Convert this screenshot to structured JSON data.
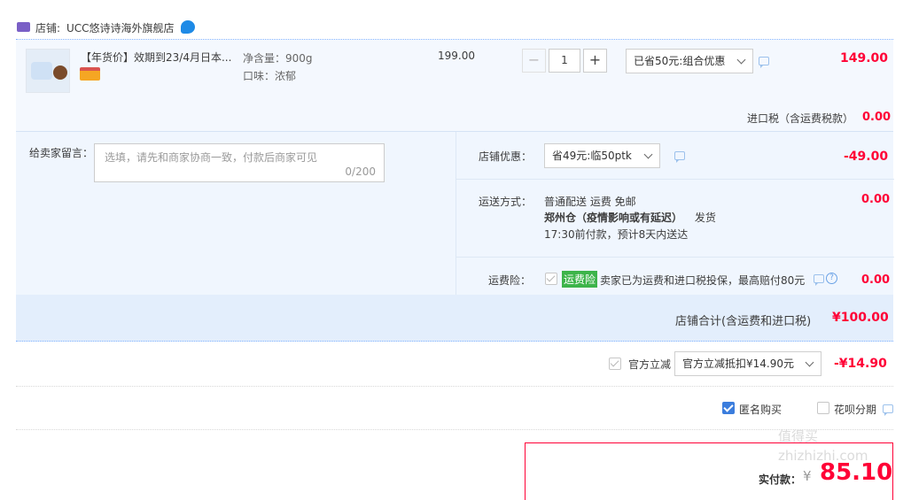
{
  "shop": {
    "label": "店铺:",
    "name": "UCC悠诗诗海外旗舰店"
  },
  "item": {
    "title": "【年货价】效期到23/4月日本...",
    "attr_weight": "净含量：900g",
    "attr_flavor": "口味：浓郁",
    "unit_price": "199.00",
    "quantity": "1",
    "discount_select": "已省50元:组合优惠",
    "subtotal": "149.00"
  },
  "tax": {
    "label": "进口税（含运费税款）",
    "value": "0.00"
  },
  "message": {
    "label": "给卖家留言：",
    "placeholder": "选填，请先和商家协商一致，付款后商家可见",
    "counter": "0/200"
  },
  "shop_discount": {
    "label": "店铺优惠：",
    "select": "省49元:临50ptk",
    "value": "-49.00"
  },
  "shipping": {
    "label": "运送方式：",
    "method": "普通配送 运费 免邮",
    "warehouse": "郑州仓（疫情影响或有延迟）",
    "warehouse_suffix": "发货",
    "eta": "17:30前付款，预计8天内送达",
    "value": "0.00"
  },
  "insurance": {
    "label": "运费险：",
    "tag": "运费险",
    "desc": "卖家已为运费和进口税投保，最高赔付80元",
    "value": "0.00"
  },
  "shop_total": {
    "label": "店铺合计(含运费和进口税)",
    "value": "¥100.00"
  },
  "official": {
    "label": "官方立减",
    "select": "官方立减抵扣¥14.90元",
    "value": "-¥14.90"
  },
  "options": {
    "anonymous": "匿名购买",
    "huabei": "花呗分期"
  },
  "payment": {
    "label": "实付款：",
    "currency": "¥",
    "amount": "85.10"
  },
  "watermark": "值得买 zhizhizhi.com"
}
